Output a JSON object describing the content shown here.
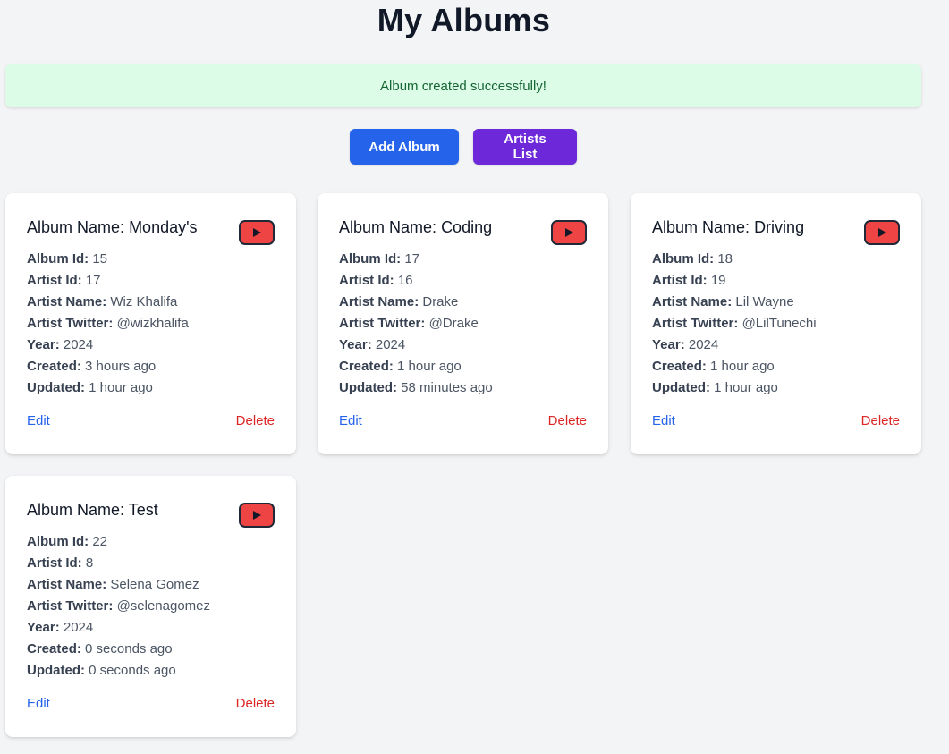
{
  "page": {
    "title": "My Albums"
  },
  "alert": {
    "message": "Album created successfully!"
  },
  "actions": {
    "add_album": "Add Album",
    "artists_list": "Artists List"
  },
  "labels": {
    "album_name": "Album Name:",
    "album_id": "Album Id:",
    "artist_id": "Artist Id:",
    "artist_name": "Artist Name:",
    "artist_twitter": "Artist Twitter:",
    "year": "Year:",
    "created": "Created:",
    "updated": "Updated:",
    "edit": "Edit",
    "delete": "Delete"
  },
  "colors": {
    "primary_button": "#2563eb",
    "secondary_button": "#6d28d9",
    "delete_link": "#dc2626",
    "alert_bg": "#dcfce7",
    "youtube_icon": "#ef4444"
  },
  "albums": [
    {
      "name": "Monday's",
      "album_id": "15",
      "artist_id": "17",
      "artist_name": "Wiz Khalifa",
      "artist_twitter": "@wizkhalifa",
      "year": "2024",
      "created": "3 hours ago",
      "updated": "1 hour ago",
      "icon": "youtube-icon"
    },
    {
      "name": "Coding",
      "album_id": "17",
      "artist_id": "16",
      "artist_name": "Drake",
      "artist_twitter": "@Drake",
      "year": "2024",
      "created": "1 hour ago",
      "updated": "58 minutes ago",
      "icon": "youtube-icon"
    },
    {
      "name": "Driving",
      "album_id": "18",
      "artist_id": "19",
      "artist_name": "Lil Wayne",
      "artist_twitter": "@LilTunechi",
      "year": "2024",
      "created": "1 hour ago",
      "updated": "1 hour ago",
      "icon": "youtube-icon"
    },
    {
      "name": "Test",
      "album_id": "22",
      "artist_id": "8",
      "artist_name": "Selena Gomez",
      "artist_twitter": "@selenagomez",
      "year": "2024",
      "created": "0 seconds ago",
      "updated": "0 seconds ago",
      "icon": "youtube-icon"
    }
  ]
}
